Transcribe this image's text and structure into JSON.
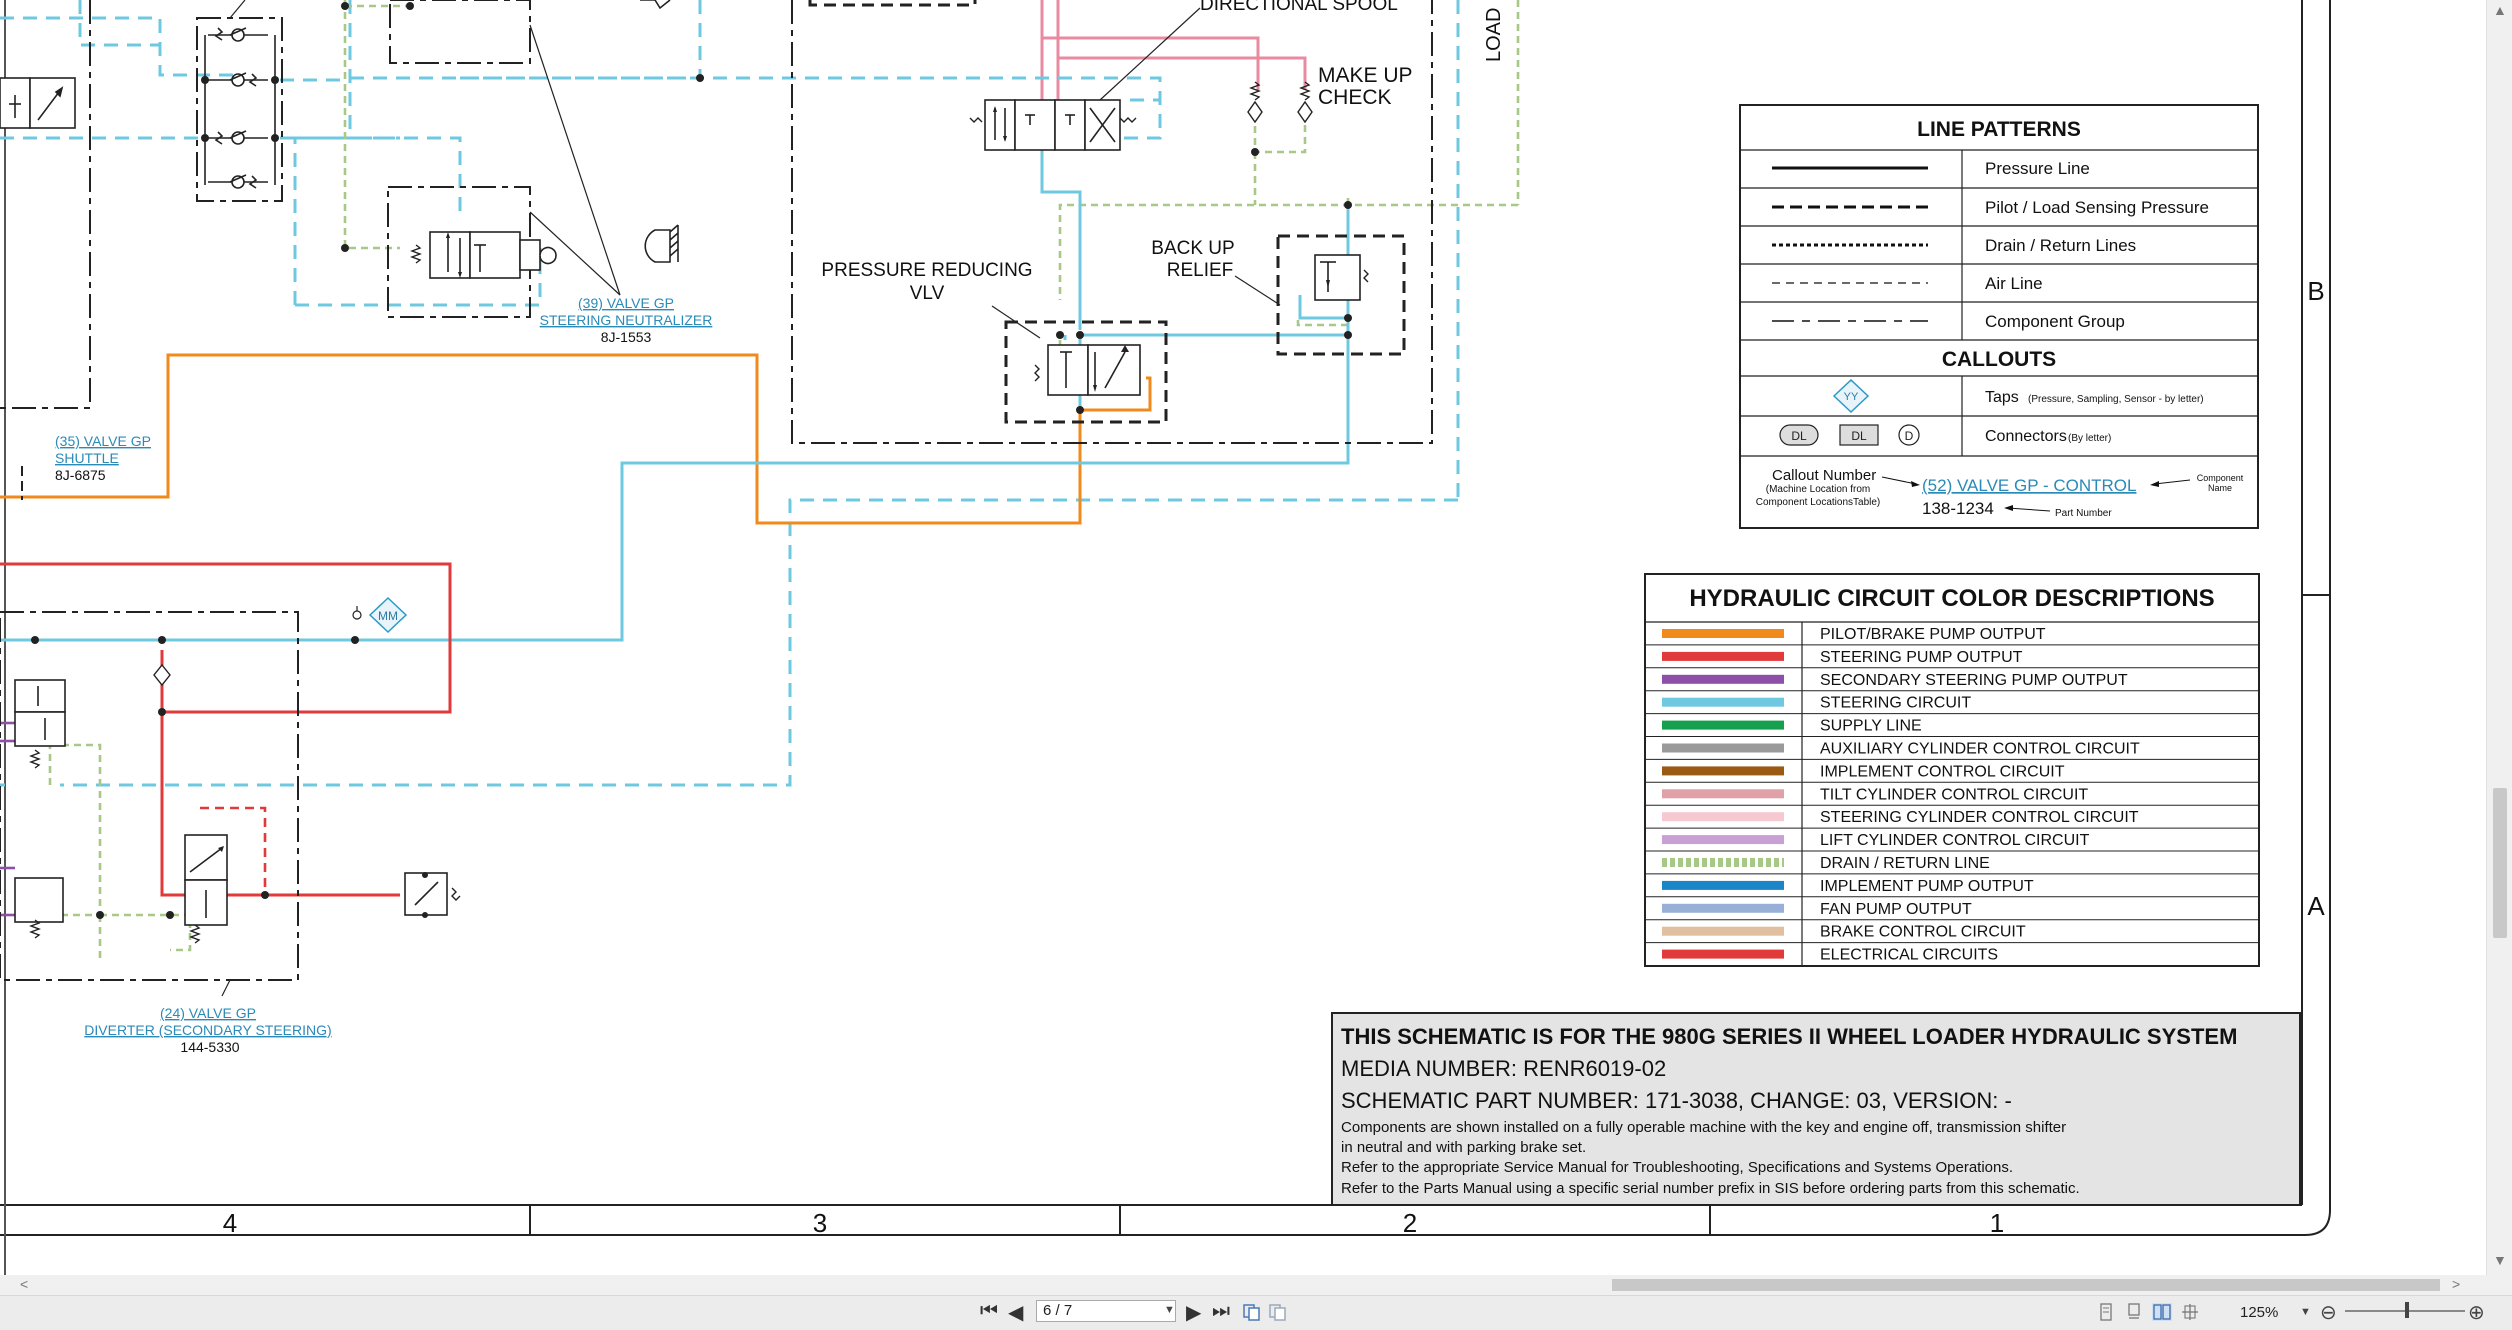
{
  "schematic": {
    "labels": {
      "directional_spool": "DIRECTIONAL SPOOL",
      "make_up_1": "MAKE UP",
      "make_up_2": "CHECK",
      "load": "LOAD",
      "pressure_reducing_1": "PRESSURE REDUCING",
      "pressure_reducing_2": "VLV",
      "back_up_1": "BACK UP",
      "back_up_2": "RELIEF",
      "mm_tap": "MM"
    },
    "callouts": {
      "valve39_1": "(39) VALVE GP",
      "valve39_2": "STEERING NEUTRALIZER",
      "valve39_pn": "8J-1553",
      "valve35_1": "(35) VALVE GP",
      "valve35_2": "SHUTTLE",
      "valve35_pn": "8J-6875",
      "valve24_1": "(24) VALVE GP",
      "valve24_2": "DIVERTER (SECONDARY STEERING)",
      "valve24_pn": "144-5330"
    },
    "grid": {
      "cols": [
        "4",
        "3",
        "2",
        "1"
      ],
      "rows": [
        "B",
        "A"
      ]
    }
  },
  "legend": {
    "line_patterns_title": "LINE PATTERNS",
    "patterns": [
      {
        "label": "Pressure Line"
      },
      {
        "label": "Pilot / Load Sensing Pressure"
      },
      {
        "label": "Drain / Return Lines"
      },
      {
        "label": "Air Line"
      },
      {
        "label": "Component Group"
      }
    ],
    "callouts_title": "CALLOUTS",
    "taps_label": "Taps",
    "taps_note": "(Pressure, Sampling, Sensor - by letter)",
    "tap_sym": "YY",
    "connectors_label": "Connectors",
    "connectors_note": "(By letter)",
    "conn_dl": "DL",
    "conn_d": "D",
    "example": {
      "callout_number": "Callout Number",
      "machine_loc_1": "(Machine Location from",
      "machine_loc_2": "Component LocationsTable)",
      "name": "(52) VALVE GP - CONTROL",
      "component_1": "Component",
      "component_2": "Name",
      "part": "138-1234",
      "part_label": "Part Number"
    }
  },
  "colors": {
    "title": "HYDRAULIC CIRCUIT COLOR DESCRIPTIONS",
    "items": [
      {
        "color": "#f08a1c",
        "label": "PILOT/BRAKE PUMP OUTPUT"
      },
      {
        "color": "#e03a3a",
        "label": "STEERING PUMP OUTPUT"
      },
      {
        "color": "#8e4fa8",
        "label": "SECONDARY STEERING PUMP OUTPUT"
      },
      {
        "color": "#6ec8e0",
        "label": "STEERING CIRCUIT"
      },
      {
        "color": "#15a050",
        "label": "SUPPLY LINE"
      },
      {
        "color": "#9a9a9a",
        "label": "AUXILIARY CYLINDER CONTROL CIRCUIT"
      },
      {
        "color": "#9a5a14",
        "label": "IMPLEMENT CONTROL CIRCUIT"
      },
      {
        "color": "#e0a0a8",
        "label": "TILT CYLINDER CONTROL CIRCUIT"
      },
      {
        "color": "#f6c8d0",
        "label": "STEERING CYLINDER CONTROL CIRCUIT"
      },
      {
        "color": "#c8a0d4",
        "label": "LIFT CYLINDER CONTROL CIRCUIT"
      },
      {
        "color": "#a8c888",
        "label": "DRAIN / RETURN LINE"
      },
      {
        "color": "#1a86c8",
        "label": "IMPLEMENT PUMP OUTPUT"
      },
      {
        "color": "#98b0d8",
        "label": "FAN PUMP OUTPUT"
      },
      {
        "color": "#e0c0a0",
        "label": "BRAKE CONTROL CIRCUIT"
      },
      {
        "color": "#e03a3a",
        "label": "ELECTRICAL CIRCUITS"
      }
    ]
  },
  "title_block": {
    "title": "THIS SCHEMATIC IS FOR THE 980G SERIES II WHEEL LOADER HYDRAULIC SYSTEM",
    "media": "MEDIA NUMBER: RENR6019-02",
    "part": "SCHEMATIC PART NUMBER: 171-3038, CHANGE: 03, VERSION: -",
    "note1": "Components are shown installed on a fully operable machine with the key and engine off, transmission shifter",
    "note2": "in neutral and with parking brake set.",
    "note3": "Refer to the appropriate Service Manual for Troubleshooting, Specifications and Systems Operations.",
    "note4": "Refer to the Parts Manual using a specific serial number prefix in SIS before ordering parts from this schematic."
  },
  "viewer": {
    "page_value": "6 / 7",
    "zoom": "125%"
  }
}
